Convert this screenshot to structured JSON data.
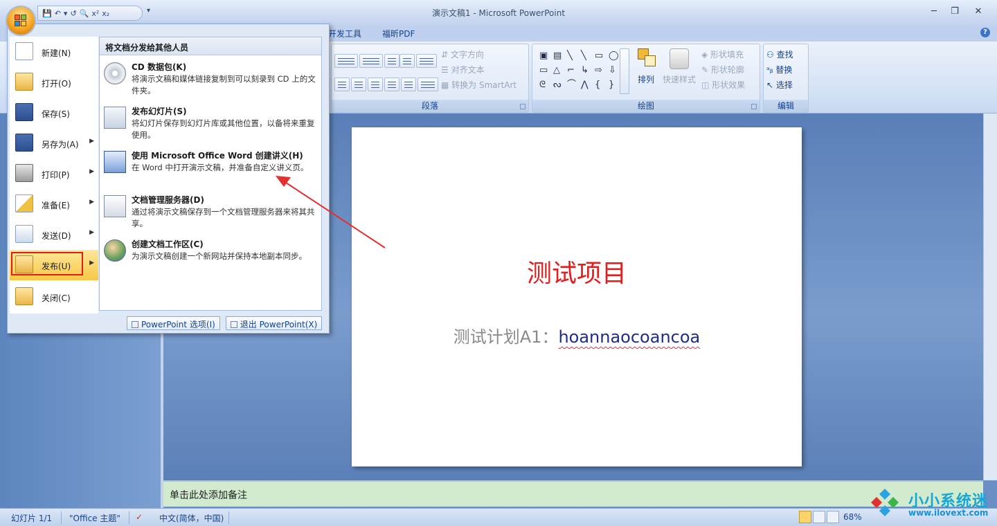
{
  "window": {
    "title": "演示文稿1 - Microsoft PowerPoint",
    "minimize": "─",
    "restore": "❐",
    "close": "✕"
  },
  "qat": {
    "items": [
      "💾",
      "↶",
      "▾",
      "↺",
      "🔍",
      "x²",
      "x₂"
    ],
    "more": "▾"
  },
  "tabs": [
    "开发工具",
    "福昕PDF"
  ],
  "ribbon": {
    "paragraph": {
      "label": "段落",
      "text_direction": "文字方向",
      "align_text": "对齐文本",
      "convert_smartart": "转换为 SmartArt"
    },
    "drawing": {
      "label": "绘图",
      "arrange": "排列",
      "quick_styles": "快速样式",
      "shape_fill": "形状填充",
      "shape_outline": "形状轮廓",
      "shape_effects": "形状效果",
      "shapes": [
        "▣",
        "▤",
        "╲",
        "╲",
        "▭",
        "◯",
        "▭",
        "△",
        "⌐",
        "↳",
        "⇨",
        "⇩",
        "ᘓ",
        "ᔓ",
        "⌒",
        "⋀",
        "{",
        "}"
      ]
    },
    "editing": {
      "label": "编辑",
      "find": "查找",
      "replace": "替换",
      "select": "选择"
    }
  },
  "office_menu": {
    "left_items": [
      {
        "label": "新建(N)",
        "arrow": ""
      },
      {
        "label": "打开(O)",
        "arrow": ""
      },
      {
        "label": "保存(S)",
        "arrow": ""
      },
      {
        "label": "另存为(A)",
        "arrow": "▶"
      },
      {
        "label": "打印(P)",
        "arrow": "▶"
      },
      {
        "label": "准备(E)",
        "arrow": "▶"
      },
      {
        "label": "发送(D)",
        "arrow": "▶"
      },
      {
        "label": "发布(U)",
        "arrow": "▶"
      },
      {
        "label": "关闭(C)",
        "arrow": ""
      }
    ],
    "panel_header": "将文档分发给其他人员",
    "right_items": [
      {
        "title": "CD 数据包(K)",
        "desc": "将演示文稿和媒体链接复制到可以刻录到 CD 上的文件夹。"
      },
      {
        "title": "发布幻灯片(S)",
        "desc": "将幻灯片保存到幻灯片库或其他位置，以备将来重复使用。"
      },
      {
        "title": "使用 Microsoft Office Word 创建讲义(H)",
        "desc": "在 Word 中打开演示文稿，并准备自定义讲义页。"
      },
      {
        "title": "文档管理服务器(D)",
        "desc": "通过将演示文稿保存到一个文档管理服务器来将其共享。"
      },
      {
        "title": "创建文档工作区(C)",
        "desc": "为演示文稿创建一个新网站并保持本地副本同步。"
      }
    ],
    "options_button": "PowerPoint 选项(I)",
    "exit_button": "退出 PowerPoint(X)"
  },
  "slide": {
    "title": "测试项目",
    "body_prefix": "测试计划A1：",
    "body_link": "hoannaocoancoa"
  },
  "notes": {
    "placeholder": "单击此处添加备注"
  },
  "statusbar": {
    "slide_count": "幻灯片 1/1",
    "theme": "\"Office 主题\"",
    "language": "中文(简体，中国)",
    "zoom": "68%"
  },
  "watermark": {
    "name": "小小系统迷",
    "url": "www.ilovext.com"
  },
  "colors": {
    "slide_title": "#e02020",
    "highlight_box": "#e21b1b",
    "arrow": "#e23030"
  }
}
